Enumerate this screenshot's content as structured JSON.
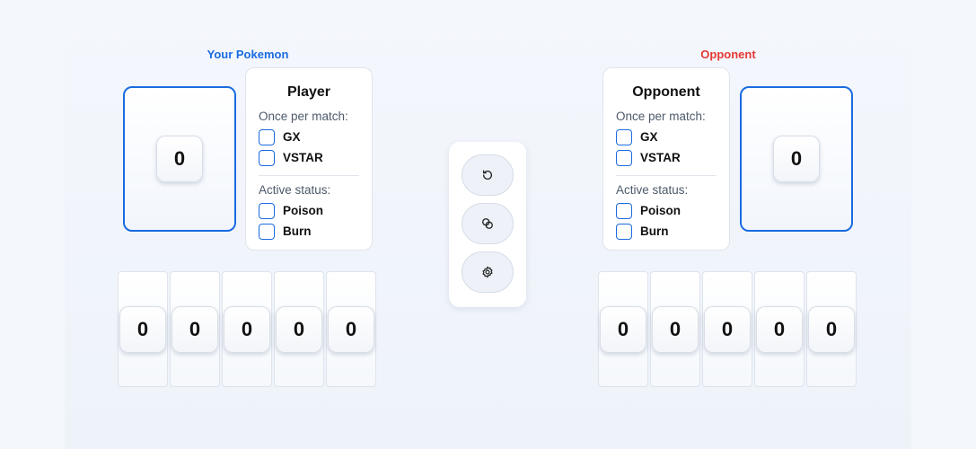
{
  "player": {
    "side_label": "Your Pokemon",
    "active_value": "0",
    "card_title": "Player",
    "once_label": "Once per match:",
    "once_items": [
      "GX",
      "VSTAR"
    ],
    "status_label": "Active status:",
    "status_items": [
      "Poison",
      "Burn"
    ],
    "bench": [
      "0",
      "0",
      "0",
      "0",
      "0"
    ]
  },
  "opponent": {
    "side_label": "Opponent",
    "active_value": "0",
    "card_title": "Opponent",
    "once_label": "Once per match:",
    "once_items": [
      "GX",
      "VSTAR"
    ],
    "status_label": "Active status:",
    "status_items": [
      "Poison",
      "Burn"
    ],
    "bench": [
      "0",
      "0",
      "0",
      "0",
      "0"
    ]
  },
  "toolbar": {
    "icons": [
      "reset-icon",
      "coin-flip-icon",
      "settings-icon"
    ]
  },
  "colors": {
    "accent": "#1a6be0",
    "opponent": "#e53935"
  }
}
